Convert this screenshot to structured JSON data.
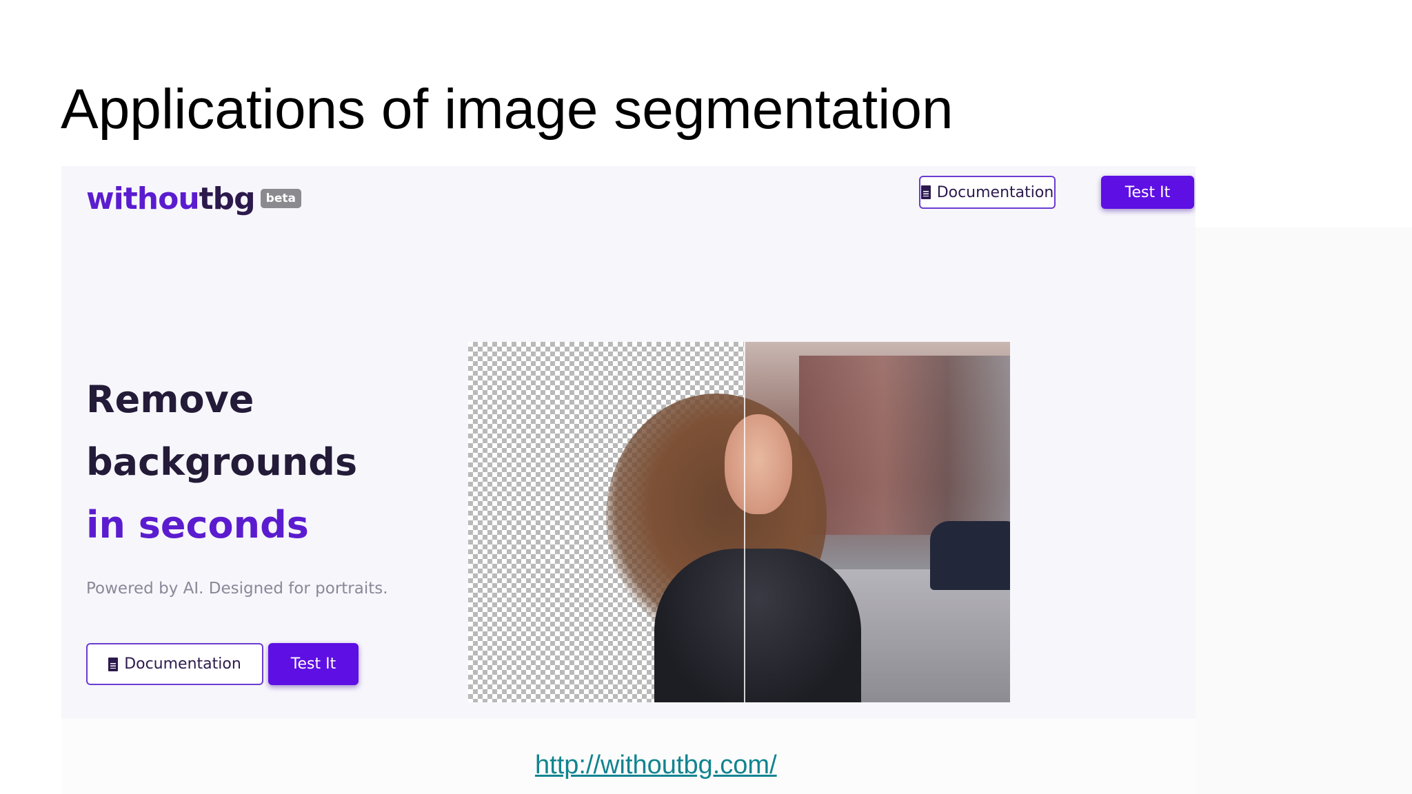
{
  "slide": {
    "title": "Applications of image segmentation",
    "link": "http://withoutbg.com/"
  },
  "site": {
    "logo": {
      "main": "withoutbg",
      "part1": "withou",
      "part2": "tbg",
      "badge": "beta"
    },
    "nav": {
      "documentation_label": "Documentation",
      "test_label": "Test It"
    },
    "hero": {
      "line1": "Remove",
      "line2": "backgrounds",
      "line3": "in seconds",
      "subtitle": "Powered by AI. Designed for portraits.",
      "documentation_label": "Documentation",
      "test_label": "Test It"
    }
  },
  "colors": {
    "brand": "#5b1ccf",
    "button": "#5e0fe3",
    "link": "#11848f"
  }
}
